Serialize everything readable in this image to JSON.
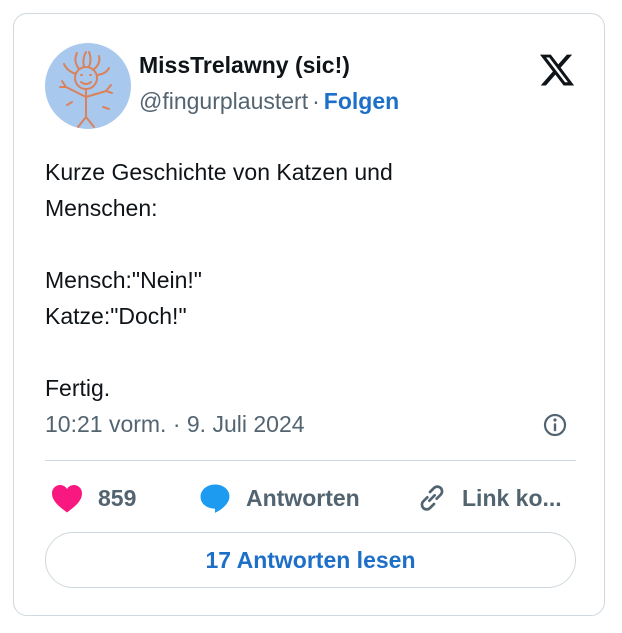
{
  "author": {
    "name": "MissTrelawny (sic!)",
    "handle": "@fingurplaustert",
    "separator": "·",
    "follow_label": "Folgen"
  },
  "tweet": {
    "lines": [
      "Kurze Geschichte von Katzen und",
      "Menschen:",
      "",
      "Mensch:\"Nein!\"",
      "Katze:\"Doch!\"",
      "",
      "Fertig."
    ],
    "timestamp": "10:21 vorm. · 9. Juli 2024"
  },
  "actions": {
    "like_count": "859",
    "reply_label": "Antworten",
    "copy_link_label": "Link ko..."
  },
  "read_replies_label": "17 Antworten lesen",
  "icons": {
    "brand": "x-logo-icon",
    "info": "info-icon",
    "like": "heart-icon",
    "reply": "speech-bubble-icon",
    "copy": "link-icon"
  },
  "colors": {
    "accent": "#1d6fc7",
    "heart": "#f91880",
    "reply_bubble": "#1d9bf0",
    "muted": "#536471",
    "border": "#cfd9de",
    "avatar_bg": "#a9c8ee",
    "avatar_drawing": "#d9825b"
  }
}
